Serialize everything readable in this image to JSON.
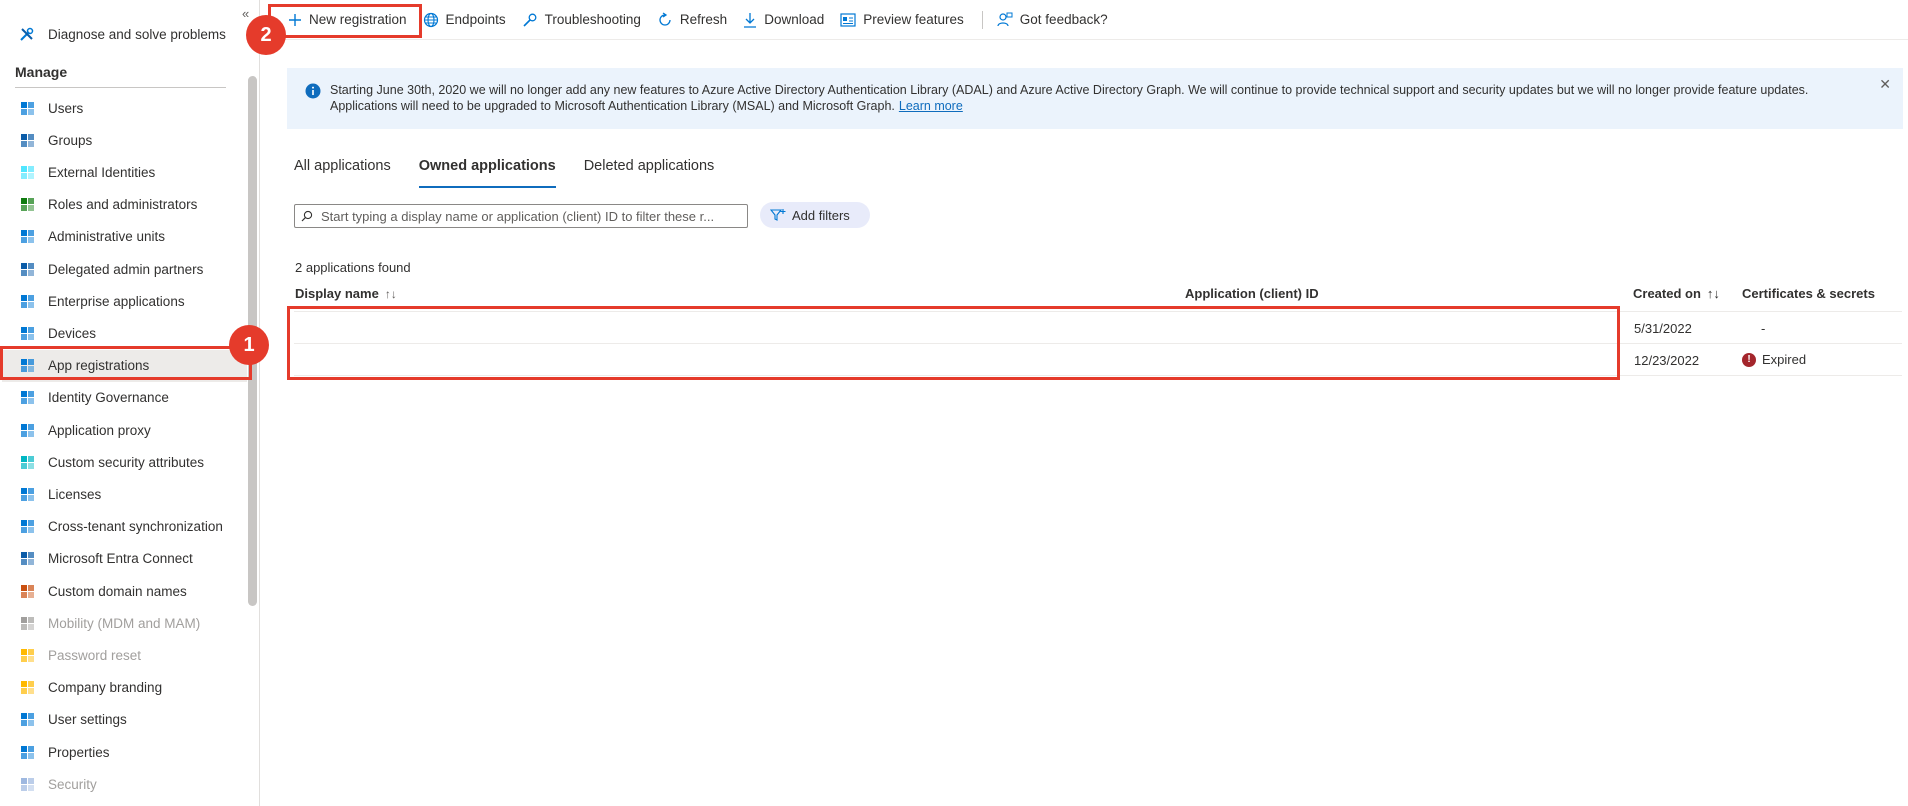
{
  "sidebar": {
    "collapse_glyph": "«",
    "top_item": {
      "label": "Diagnose and solve problems",
      "icon": "wrench-cross-icon"
    },
    "section_heading": "Manage",
    "items": [
      {
        "label": "Users",
        "icon": "user-icon"
      },
      {
        "label": "Groups",
        "icon": "groups-icon"
      },
      {
        "label": "External Identities",
        "icon": "external-identities-icon"
      },
      {
        "label": "Roles and administrators",
        "icon": "roles-icon"
      },
      {
        "label": "Administrative units",
        "icon": "admin-units-icon"
      },
      {
        "label": "Delegated admin partners",
        "icon": "partners-icon"
      },
      {
        "label": "Enterprise applications",
        "icon": "grid-apps-icon"
      },
      {
        "label": "Devices",
        "icon": "devices-icon"
      },
      {
        "label": "App registrations",
        "icon": "app-registrations-icon"
      },
      {
        "label": "Identity Governance",
        "icon": "identity-governance-icon"
      },
      {
        "label": "Application proxy",
        "icon": "app-proxy-icon"
      },
      {
        "label": "Custom security attributes",
        "icon": "security-attributes-icon"
      },
      {
        "label": "Licenses",
        "icon": "licenses-icon"
      },
      {
        "label": "Cross-tenant synchronization",
        "icon": "sync-icon"
      },
      {
        "label": "Microsoft Entra Connect",
        "icon": "entra-connect-icon"
      },
      {
        "label": "Custom domain names",
        "icon": "domain-icon"
      },
      {
        "label": "Mobility (MDM and MAM)",
        "icon": "mobility-icon"
      },
      {
        "label": "Password reset",
        "icon": "key-icon"
      },
      {
        "label": "Company branding",
        "icon": "branding-icon"
      },
      {
        "label": "User settings",
        "icon": "user-settings-icon"
      },
      {
        "label": "Properties",
        "icon": "properties-icon"
      },
      {
        "label": "Security",
        "icon": "shield-icon"
      }
    ]
  },
  "toolbar": {
    "new_registration": "New registration",
    "endpoints": "Endpoints",
    "troubleshooting": "Troubleshooting",
    "refresh": "Refresh",
    "download": "Download",
    "preview_features": "Preview features",
    "feedback": "Got feedback?"
  },
  "markers": {
    "one": "1",
    "two": "2"
  },
  "banner": {
    "text": "Starting June 30th, 2020 we will no longer add any new features to Azure Active Directory Authentication Library (ADAL) and Azure Active Directory Graph. We will continue to provide technical support and security updates but we will no longer provide feature updates. Applications will need to be upgraded to Microsoft Authentication Library (MSAL) and Microsoft Graph.",
    "link": "Learn more",
    "close_glyph": "✕"
  },
  "tabs": [
    "All applications",
    "Owned applications",
    "Deleted applications"
  ],
  "filter": {
    "placeholder": "Start typing a display name or application (client) ID to filter these r...",
    "add_filters": "Add filters"
  },
  "results": {
    "count_label": "2 applications found",
    "columns": {
      "display_name": "Display name",
      "client_id": "Application (client) ID",
      "created_on": "Created on",
      "certs": "Certificates & secrets"
    },
    "sort_glyph_name": "↑↓",
    "sort_glyph_created": "↑↓",
    "rows": [
      {
        "created_on": "5/31/2022",
        "certs": "-"
      },
      {
        "created_on": "12/23/2022",
        "certs": "Expired"
      }
    ]
  },
  "colors": {
    "accent": "#0f6cbd",
    "highlight": "#e53b2b",
    "banner_bg": "#ebf3fc",
    "expired": "#a4262c"
  }
}
